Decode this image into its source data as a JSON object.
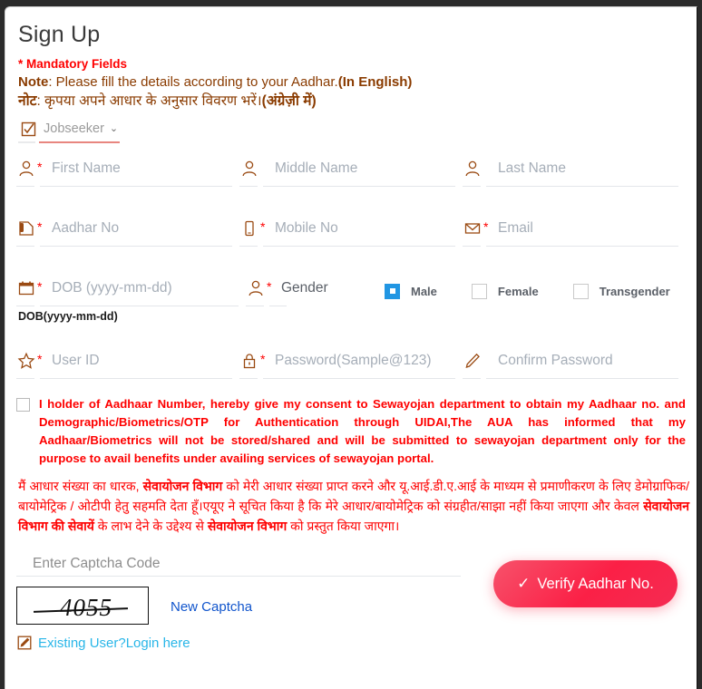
{
  "page": {
    "title": "Sign Up",
    "mandatory_note": "* Mandatory Fields",
    "note_en_label": "Note",
    "note_en_text": ": Please fill the details according to your Aadhar.",
    "note_en_bold": "(In English)",
    "note_hi_label": "नोट",
    "note_hi_text": ": कृपया अपने आधार के अनुसार विवरण भरें।",
    "note_hi_bold": "(अंग्रेज़ी में)"
  },
  "user_type": {
    "selected": "Jobseeker",
    "caret": "⌄"
  },
  "fields": {
    "first_name": {
      "placeholder": "First Name",
      "required": "*",
      "icon": "user-icon"
    },
    "middle_name": {
      "placeholder": "Middle Name",
      "required": "",
      "icon": "user-icon"
    },
    "last_name": {
      "placeholder": "Last Name",
      "required": "",
      "icon": "user-icon"
    },
    "aadhar_no": {
      "placeholder": "Aadhar No",
      "required": "*",
      "icon": "id-card-icon"
    },
    "mobile_no": {
      "placeholder": "Mobile No",
      "required": "*",
      "icon": "mobile-icon"
    },
    "email": {
      "placeholder": "Email",
      "required": "*",
      "icon": "envelope-icon"
    },
    "dob": {
      "placeholder": "DOB (yyyy-mm-dd)",
      "required": "*",
      "icon": "calendar-icon"
    },
    "gender": {
      "label": "Gender",
      "required": "*",
      "icon": "user-icon"
    },
    "user_id": {
      "placeholder": "User ID",
      "required": "*",
      "icon": "star-icon"
    },
    "password": {
      "placeholder": "Password(Sample@123)",
      "required": "*",
      "icon": "lock-icon"
    },
    "confirm_password": {
      "placeholder": "Confirm Password",
      "required": "",
      "icon": "pencil-icon"
    },
    "captcha": {
      "placeholder": "Enter Captcha Code"
    }
  },
  "gender_options": [
    {
      "label": "Male",
      "selected": true
    },
    {
      "label": "Female",
      "selected": false
    },
    {
      "label": "Transgender",
      "selected": false
    }
  ],
  "dob_hint": "DOB(yyyy-mm-dd)",
  "consent": {
    "checked": false,
    "text_en": "I holder of Aadhaar Number, hereby give my consent to Sewayojan department to obtain my Aadhaar no. and Demographic/Biometrics/OTP for Authentication through UIDAI,The AUA has informed that my Aadhaar/Biometrics will not be stored/shared and will be submitted to sewayojan department only for the purpose to avail benefits under availing services of sewayojan portal.",
    "text_hi_1": "मैं आधार संख्या का धारक, ",
    "text_hi_b1": "सेवायोजन विभाग",
    "text_hi_2": " को मेरी आधार संख्या प्राप्त करने और यू.आई.डी.ए.आई के माध्यम से प्रमाणीकरण के लिए डेमोग्राफिक/ बायोमेट्रिक / ओटीपी हेतु सहमति देता हूँ।एयूए ने सूचित किया है कि मेरे आधार/बायोमेट्रिक को संग्रहीत/साझा नहीं किया जाएगा और केवल ",
    "text_hi_b2": "सेवायोजन विभाग की सेवायें",
    "text_hi_3": " के लाभ देने के उद्देश्य से ",
    "text_hi_b3": "सेवायोजन विभाग",
    "text_hi_4": " को प्रस्तुत किया जाएगा।"
  },
  "captcha": {
    "code": "4055",
    "new_captcha_label": "New Captcha"
  },
  "footer": {
    "login_link": "Existing User?Login here",
    "login_icon": "pencil-square-icon"
  },
  "verify_button": {
    "label": "Verify Aadhar No.",
    "check": "✓",
    "color": "#fb2046"
  }
}
